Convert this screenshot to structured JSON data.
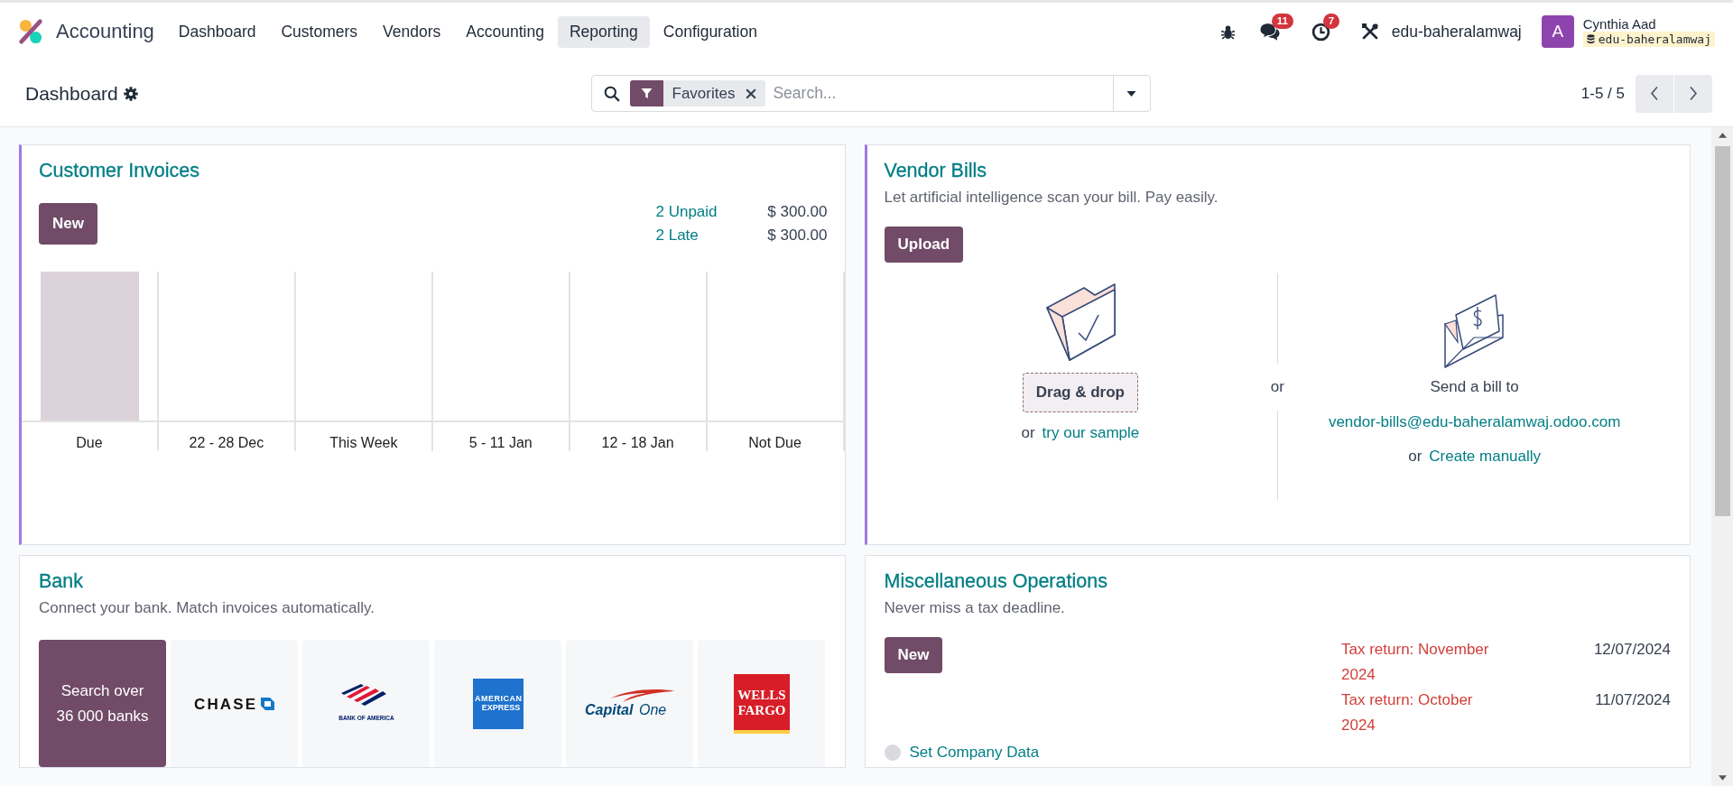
{
  "navbar": {
    "app_name": "Accounting",
    "menu": [
      {
        "label": "Dashboard",
        "selected": false
      },
      {
        "label": "Customers",
        "selected": false
      },
      {
        "label": "Vendors",
        "selected": false
      },
      {
        "label": "Accounting",
        "selected": false
      },
      {
        "label": "Reporting",
        "selected": true
      },
      {
        "label": "Configuration",
        "selected": false
      }
    ],
    "messages_badge": "11",
    "activities_badge": "7",
    "company": "edu-baheralamwaj",
    "user": {
      "initial": "A",
      "name": "Cynthia Aad",
      "database": "edu-baheralamwaj"
    }
  },
  "control_panel": {
    "title": "Dashboard",
    "filter": "Favorites",
    "search_placeholder": "Search...",
    "pager": "1-5 / 5"
  },
  "customer_invoices": {
    "title": "Customer Invoices",
    "new_button": "New",
    "summary": [
      {
        "label": "2 Unpaid",
        "amount": "$ 300.00"
      },
      {
        "label": "2 Late",
        "amount": "$ 300.00"
      }
    ],
    "columns": [
      {
        "label": "Due",
        "kind": "bar"
      },
      {
        "label": "22 - 28 Dec",
        "kind": "empty"
      },
      {
        "label": "This Week",
        "kind": "empty"
      },
      {
        "label": "5 - 11 Jan",
        "kind": "empty"
      },
      {
        "label": "12 - 18 Jan",
        "kind": "empty"
      },
      {
        "label": "Not Due",
        "kind": "empty"
      }
    ]
  },
  "vendor_bills": {
    "title": "Vendor Bills",
    "subtitle": "Let artificial intelligence scan your bill. Pay easily.",
    "upload_button": "Upload",
    "drag_drop": "Drag & drop",
    "or_1": "or",
    "sample_link": "try our sample",
    "or_middle": "or",
    "send_text": "Send a bill to",
    "email": "vendor-bills@edu-baheralamwaj.odoo.com",
    "or_2": "or",
    "create_link": "Create manually"
  },
  "bank": {
    "title": "Bank",
    "subtitle": "Connect your bank. Match invoices automatically.",
    "search_tile": "Search over 36 000 banks",
    "banks": [
      {
        "kind": "chase",
        "lines": [
          "CHASE"
        ]
      },
      {
        "kind": "boa",
        "lines": [
          "BANK OF AMERICA"
        ]
      },
      {
        "kind": "amex",
        "lines": [
          "AMERICAN",
          "EXPRESS"
        ]
      },
      {
        "kind": "capitalone",
        "lines": [
          "Capital",
          "One"
        ]
      },
      {
        "kind": "wellsfargo",
        "lines": [
          "WELLS",
          "FARGO"
        ]
      }
    ]
  },
  "misc": {
    "title": "Miscellaneous Operations",
    "subtitle": "Never miss a tax deadline.",
    "new_button": "New",
    "tax_returns": [
      {
        "label": "Tax return: November 2024",
        "date": "12/07/2024"
      },
      {
        "label": "Tax return: October 2024",
        "date": "11/07/2024"
      }
    ],
    "steps": [
      {
        "label": "Set Company Data",
        "done": false
      }
    ]
  }
}
